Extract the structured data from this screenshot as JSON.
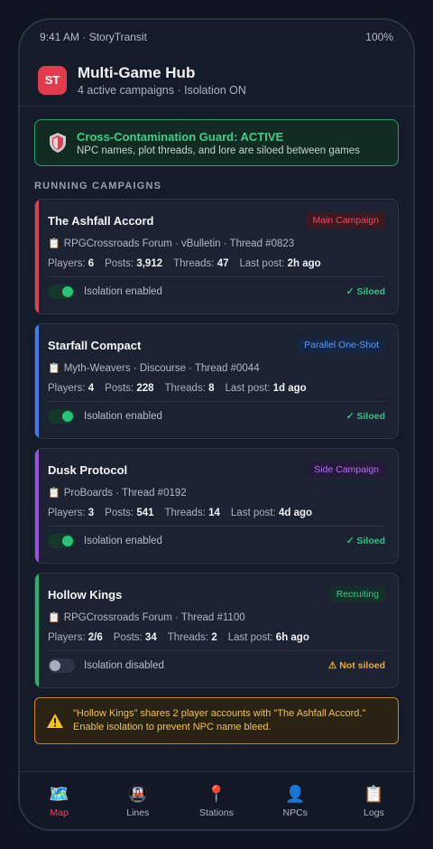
{
  "status_bar": {
    "left": "9:41 AM · StoryTransit",
    "right": "100%"
  },
  "header": {
    "logo": "ST",
    "title": "Multi-Game Hub",
    "subtitle": "4 active campaigns · Isolation ON"
  },
  "guard": {
    "icon": "shield-icon",
    "title": "Cross-Contamination Guard: ACTIVE",
    "description": "NPC names, plot threads, and lore are siloed between games"
  },
  "section_label": "RUNNING CAMPAIGNS",
  "campaigns": [
    {
      "name": "The Ashfall Accord",
      "tag": "Main Campaign",
      "accent": "#e0414f",
      "tag_bg": "#3a1a20",
      "tag_color": "#ef4b5a",
      "source": "RPGCrossroads Forum · vBulletin · Thread #0823",
      "stats": [
        {
          "label": "Players:",
          "value": "6"
        },
        {
          "label": "Posts:",
          "value": "3,912"
        },
        {
          "label": "Threads:",
          "value": "47"
        },
        {
          "label": "Last post:",
          "value": "2h ago"
        }
      ],
      "isolation_on": true,
      "isolation_label": "Isolation enabled",
      "isolation_state": "✓ Siloed",
      "state_color": "#2fc57e"
    },
    {
      "name": "Starfall Compact",
      "tag": "Parallel One-Shot",
      "accent": "#3d7ee8",
      "tag_bg": "#162640",
      "tag_color": "#5a9af5",
      "source": "Myth-Weavers · Discourse · Thread #0044",
      "stats": [
        {
          "label": "Players:",
          "value": "4"
        },
        {
          "label": "Posts:",
          "value": "228"
        },
        {
          "label": "Threads:",
          "value": "8"
        },
        {
          "label": "Last post:",
          "value": "1d ago"
        }
      ],
      "isolation_on": true,
      "isolation_label": "Isolation enabled",
      "isolation_state": "✓ Siloed",
      "state_color": "#2fc57e"
    },
    {
      "name": "Dusk Protocol",
      "tag": "Side Campaign",
      "accent": "#9a4fe0",
      "tag_bg": "#261a3a",
      "tag_color": "#b46cf5",
      "source": "ProBoards · Thread #0192",
      "stats": [
        {
          "label": "Players:",
          "value": "3"
        },
        {
          "label": "Posts:",
          "value": "541"
        },
        {
          "label": "Threads:",
          "value": "14"
        },
        {
          "label": "Last post:",
          "value": "4d ago"
        }
      ],
      "isolation_on": true,
      "isolation_label": "Isolation enabled",
      "isolation_state": "✓ Siloed",
      "state_color": "#2fc57e"
    },
    {
      "name": "Hollow Kings",
      "tag": "Recruiting",
      "accent": "#26b26a",
      "tag_bg": "#15302a",
      "tag_color": "#35c77c",
      "source": "RPGCrossroads Forum · Thread #1100",
      "stats": [
        {
          "label": "Players:",
          "value": "2/6"
        },
        {
          "label": "Posts:",
          "value": "34"
        },
        {
          "label": "Threads:",
          "value": "2"
        },
        {
          "label": "Last post:",
          "value": "6h ago"
        }
      ],
      "isolation_on": false,
      "isolation_label": "Isolation disabled",
      "isolation_state": "⚠ Not siloed",
      "state_color": "#f0a828"
    }
  ],
  "warning": {
    "icon": "warning-icon",
    "text": "\"Hollow Kings\" shares 2 player accounts with \"The Ashfall Accord.\" Enable isolation to prevent NPC name bleed."
  },
  "tabs": [
    {
      "label": "Map",
      "icon": "map-icon",
      "glyph": "🗺️",
      "active": true
    },
    {
      "label": "Lines",
      "icon": "train-icon",
      "glyph": "🚇",
      "active": false
    },
    {
      "label": "Stations",
      "icon": "pin-icon",
      "glyph": "📍",
      "active": false
    },
    {
      "label": "NPCs",
      "icon": "person-icon",
      "glyph": "👤",
      "active": false
    },
    {
      "label": "Logs",
      "icon": "clipboard-icon",
      "glyph": "📋",
      "active": false
    }
  ]
}
